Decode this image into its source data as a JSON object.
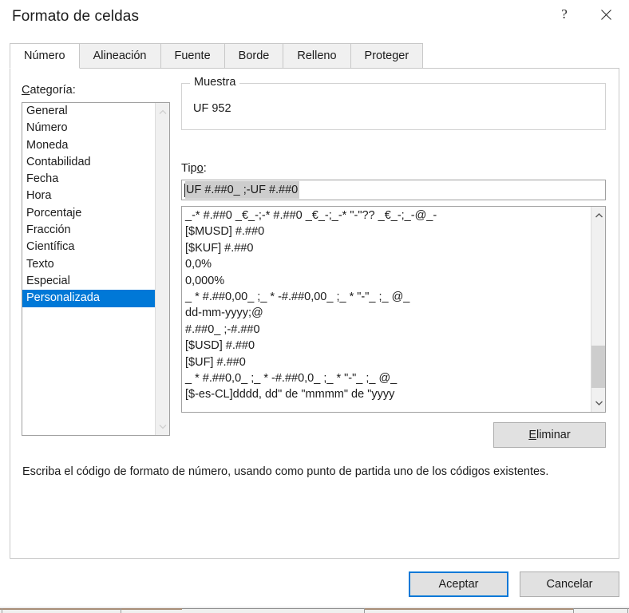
{
  "window": {
    "title": "Formato de celdas",
    "help_icon": "question-mark-icon",
    "help_glyph": "?",
    "close_icon": "close-icon",
    "accent_color": "#0078D7",
    "selection_color": "#0078D7",
    "inactive_selection_color": "#CDCDCD"
  },
  "tabs": [
    {
      "label": "Número",
      "active": true
    },
    {
      "label": "Alineación",
      "active": false
    },
    {
      "label": "Fuente",
      "active": false
    },
    {
      "label": "Borde",
      "active": false
    },
    {
      "label": "Relleno",
      "active": false
    },
    {
      "label": "Proteger",
      "active": false
    }
  ],
  "category": {
    "label_prefix": "",
    "label_accel": "C",
    "label_suffix": "ategoría:",
    "items": [
      "General",
      "Número",
      "Moneda",
      "Contabilidad",
      "Fecha",
      "Hora",
      "Porcentaje",
      "Fracción",
      "Científica",
      "Texto",
      "Especial",
      "Personalizada"
    ],
    "selected": "Personalizada",
    "selected_index": 11
  },
  "sample": {
    "legend": "Muestra",
    "value": "UF 952"
  },
  "type_field": {
    "label_prefix": "Tip",
    "label_accel": "o",
    "label_suffix": ":",
    "value": "UF #.##0_ ;-UF #.##0"
  },
  "format_list": {
    "items": [
      "_-* #.##0 _€_-;-* #.##0 _€_-;_-* \"-\"?? _€_-;_-@_-",
      "[$MUSD] #.##0",
      "[$KUF] #.##0",
      "0,0%",
      "0,000%",
      "_ * #.##0,00_ ;_ * -#.##0,00_ ;_ * \"-\"_ ;_ @_",
      "dd-mm-yyyy;@",
      "#.##0_ ;-#.##0",
      "[$USD] #.##0",
      "[$UF] #.##0",
      "_ * #.##0,0_ ;_ * -#.##0,0_ ;_ * \"-\"_ ;_ @_",
      "[$-es-CL]dddd, dd\" de \"mmmm\" de \"yyyy"
    ]
  },
  "delete_button": {
    "prefix": "",
    "accel": "E",
    "suffix": "liminar"
  },
  "hint": {
    "text": "Escriba el código de formato de número, usando como punto de partida uno de los códigos existentes."
  },
  "footer": {
    "accept_label": "Aceptar",
    "cancel_label": "Cancelar"
  }
}
